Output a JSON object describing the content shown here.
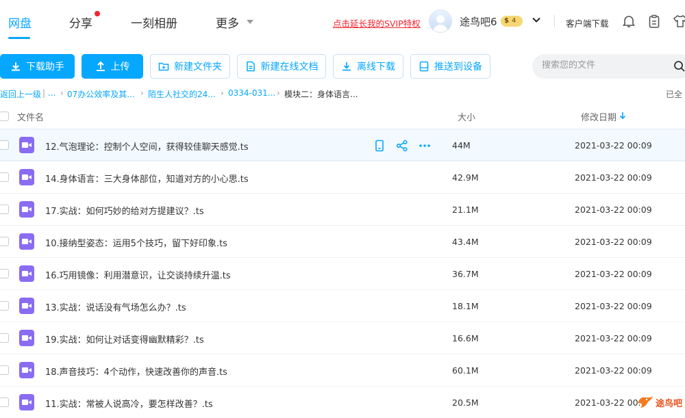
{
  "nav": {
    "tabs": [
      {
        "label": "网盘"
      },
      {
        "label": "分享"
      },
      {
        "label": "一刻相册"
      },
      {
        "label": "更多"
      }
    ],
    "promo": "点击延长我的SVIP特权",
    "username": "途鸟吧6",
    "vip_level": "4",
    "client_download": "客户端下载",
    "icons": [
      "bell-icon",
      "clipboard-icon",
      "shirt-icon"
    ]
  },
  "toolbar": {
    "download_helper": "下载助手",
    "upload": "上传",
    "new_folder": "新建文件夹",
    "new_online_doc": "新建在线文档",
    "offline_download": "离线下载",
    "push_to_device": "推送到设备",
    "search_placeholder": "搜索您的文件"
  },
  "breadcrumb": {
    "back": "返回上一级",
    "sep": "|",
    "ellipsis": "...",
    "items": [
      "07办公效率及其...",
      "陌生人社交的24...",
      "0334-031..."
    ],
    "current": "模块二：身体语言..."
  },
  "selected_label": "已全",
  "columns": {
    "name": "文件名",
    "size": "大小",
    "modified": "修改日期"
  },
  "files": [
    {
      "name": "12.气泡理论：控制个人空间，获得较佳聊天感觉.ts",
      "size": "44M",
      "date": "2021-03-22 00:09"
    },
    {
      "name": "14.身体语言：三大身体部位，知道对方的小心思.ts",
      "size": "42.9M",
      "date": "2021-03-22 00:09"
    },
    {
      "name": "17.实战：如何巧妙的给对方提建议？.ts",
      "size": "21.1M",
      "date": "2021-03-22 00:09"
    },
    {
      "name": "10.接纳型姿态：运用5个技巧，留下好印象.ts",
      "size": "43.4M",
      "date": "2021-03-22 00:09"
    },
    {
      "name": "16.巧用镜像：利用潜意识，让交谈持续升温.ts",
      "size": "36.7M",
      "date": "2021-03-22 00:09"
    },
    {
      "name": "13.实战：说话没有气场怎么办？.ts",
      "size": "18.1M",
      "date": "2021-03-22 00:09"
    },
    {
      "name": "19.实战：如何让对话变得幽默精彩？.ts",
      "size": "16.6M",
      "date": "2021-03-22 00:09"
    },
    {
      "name": "18.声音技巧：4个动作，快速改善你的声音.ts",
      "size": "60.1M",
      "date": "2021-03-22 00:09"
    },
    {
      "name": "11.实战：常被人说高冷，要怎样改善？.ts",
      "size": "20.5M",
      "date": "2021-03-22 00:0"
    }
  ],
  "watermark": "途鸟吧",
  "colors": {
    "accent": "#06a7ff",
    "promo": "#f5222d",
    "video_icon": "#8a6cf3",
    "hover_row": "#f2f9ff"
  }
}
